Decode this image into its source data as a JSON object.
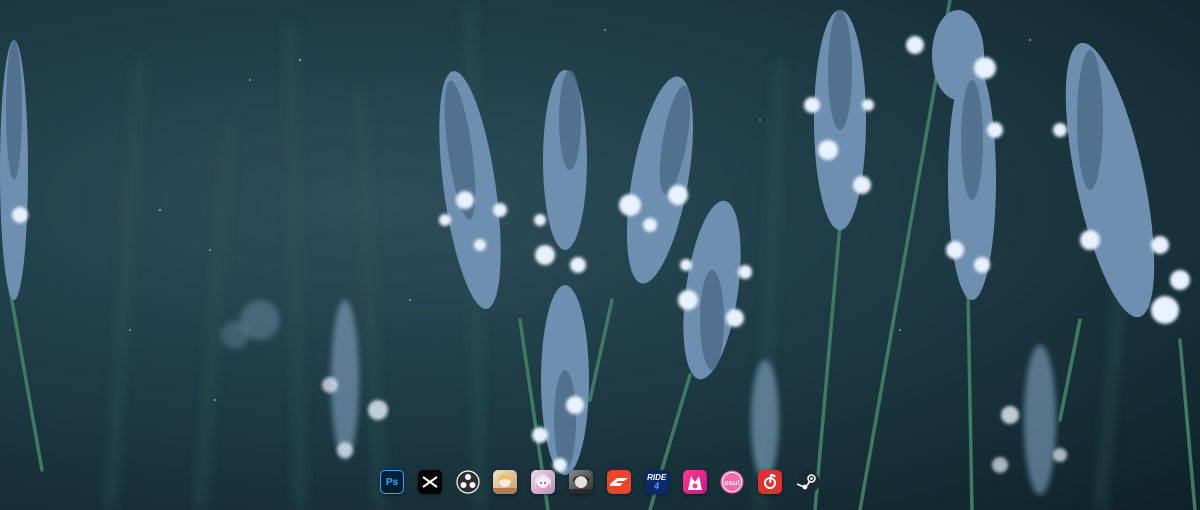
{
  "desktop": {
    "wallpaper": "lavender-field-wallpaper"
  },
  "dock": {
    "apps": [
      {
        "name": "photoshop",
        "icon": "photoshop-icon",
        "label": "Ps",
        "color": "#31a8ff"
      },
      {
        "name": "capcut",
        "icon": "capcut-icon",
        "color": "#000000"
      },
      {
        "name": "obs-studio",
        "icon": "obs-icon",
        "color": "#302e31"
      },
      {
        "name": "game-anime-1",
        "icon": "anime-game-icon",
        "color": "#f4e4c9"
      },
      {
        "name": "game-anime-2",
        "icon": "anime-game-icon",
        "color": "#f2d3e4"
      },
      {
        "name": "game-anime-3",
        "icon": "anime-game-icon",
        "color": "#5a5a5a"
      },
      {
        "name": "forza-horizon",
        "icon": "forza-icon",
        "color": "#e8452a"
      },
      {
        "name": "ride-4",
        "icon": "ride4-icon",
        "label_top": "RIDE",
        "label_bottom": "4",
        "color": "#0c2a6b"
      },
      {
        "name": "muse-dash",
        "icon": "muse-dash-icon",
        "color": "#ff3b8d"
      },
      {
        "name": "osu",
        "icon": "osu-icon",
        "label": "osu!",
        "color": "#ff66aa"
      },
      {
        "name": "netease-music",
        "icon": "netease-music-icon",
        "color": "#e03131"
      },
      {
        "name": "steam",
        "icon": "steam-icon",
        "color": "#1b2838"
      }
    ]
  }
}
